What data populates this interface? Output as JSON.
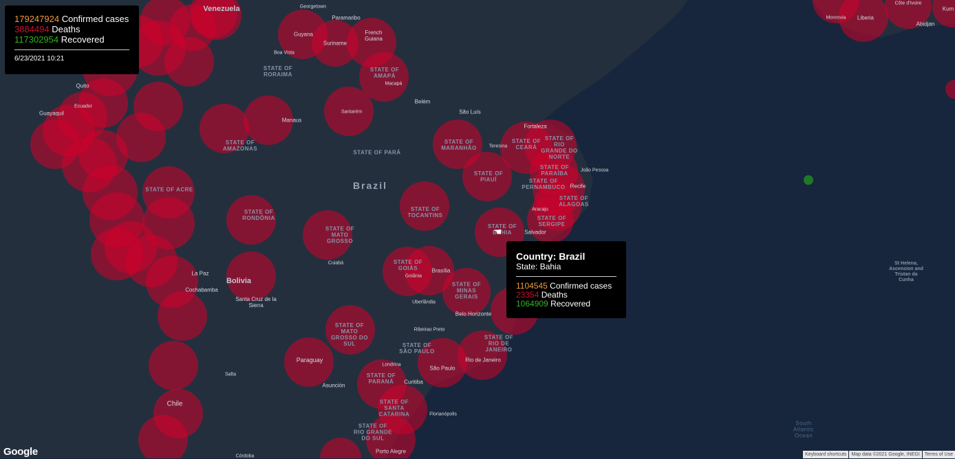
{
  "summary": {
    "confirmed": "179247924",
    "confirmed_label": "Confirmed cases",
    "deaths": "3884494",
    "deaths_label": "Deaths",
    "recovered": "117302954",
    "recovered_label": "Recovered",
    "timestamp": "6/23/2021 10:21"
  },
  "tooltip": {
    "country": "Country: Brazil",
    "state": "State: Bahia",
    "confirmed": "1104545",
    "confirmed_label": "Confirmed cases",
    "deaths": "23354",
    "deaths_label": "Deaths",
    "recovered": "1064909",
    "recovered_label": "Recovered"
  },
  "map_labels": {
    "country_brazil": "Brazil",
    "country_venezuela": "Venezuela",
    "country_bolivia": "Bolivia",
    "country_paraguay": "Paraguay",
    "country_chile": "Chile",
    "country_guyana": "Guyana",
    "country_suriname": "Suriname",
    "country_french_guiana": "French Guiana",
    "country_ecuador": "Ecuador",
    "country_liberia": "Liberia",
    "country_cote": "Côte d'Ivoire",
    "state_roraima": "STATE OF RORAIMA",
    "state_amapa": "STATE OF AMAPÁ",
    "state_amazonas": "STATE OF AMAZONAS",
    "state_para": "STATE OF PARÁ",
    "state_maranhao": "STATE OF MARANHÃO",
    "state_ceara": "STATE OF CEARÁ",
    "state_rgn": "STATE OF RIO GRANDE DO NORTE",
    "state_piaui": "STATE OF PIAUÍ",
    "state_acre": "STATE OF ACRE",
    "state_rondonia": "STATE OF RONDÔNIA",
    "state_tocantins": "STATE OF TOCANTINS",
    "state_bahia": "STATE OF BAHIA",
    "state_pernambuco": "STATE OF PERNAMBUCO",
    "state_paraiba": "STATE OF PARAÍBA",
    "state_alagoas": "STATE OF ALAGOAS",
    "state_sergipe": "STATE OF SERGIPE",
    "state_mato_grosso": "STATE OF MATO GROSSO",
    "state_goias": "STATE OF GOIÁS",
    "state_minas": "STATE OF MINAS GERAIS",
    "state_ms": "STATE OF MATO GROSSO DO SUL",
    "state_sp": "STATE OF SÃO PAULO",
    "state_rj": "STATE OF RIO DE JANEIRO",
    "state_parana": "STATE OF PARANÁ",
    "state_sc": "STATE OF SANTA CATARINA",
    "state_rgs": "STATE OF RIO GRANDE DO SUL",
    "city_georgetown": "Georgetown",
    "city_paramaribo": "Paramaribo",
    "city_boa_vista": "Boa Vista",
    "city_macapa": "Macapá",
    "city_belem": "Belém",
    "city_sao_luis": "São Luís",
    "city_fortaleza": "Fortaleza",
    "city_teresina": "Teresina",
    "city_joao_pessoa": "João Pessoa",
    "city_recife": "Recife",
    "city_manaus": "Manaus",
    "city_santarem": "Santarém",
    "city_quito": "Quito",
    "city_guayaquil": "Guayaquil",
    "city_salvador": "Salvador",
    "city_aracaju": "Aracaju",
    "city_brasilia": "Brasília",
    "city_goiania": "Goiânia",
    "city_cuiaba": "Cuiabá",
    "city_la_paz": "La Paz",
    "city_cochabamba": "Cochabamba",
    "city_santa_cruz": "Santa Cruz de la Sierra",
    "city_uberlandia": "Uberlândia",
    "city_belo_horizonte": "Belo Horizonte",
    "city_ribeirao_preto": "Ribeirao Preto",
    "city_sao_paulo": "São Paulo",
    "city_rio": "Rio de Janeiro",
    "city_londrina": "Londrina",
    "city_curitiba": "Curitiba",
    "city_florianopolis": "Florianópolis",
    "city_porto_alegre": "Porto Alegre",
    "city_asuncion": "Asunción",
    "city_salta": "Salta",
    "city_cordoba": "Córdoba",
    "city_monrovia": "Monrovia",
    "city_abidjan": "Abidjan",
    "city_kumasi": "Kum",
    "islands_st_helena": "St Helena, Ascension and Tristan da Cunha",
    "ocean_south_atlantic": "South Atlantic Ocean"
  },
  "branding": {
    "google": "Google"
  },
  "attribution": {
    "shortcuts": "Keyboard shortcuts",
    "map_data": "Map data ©2021 Google, INEGI",
    "terms": "Terms of Use"
  },
  "colors": {
    "ocean": "#17263c",
    "land": "#242f3e",
    "bubble": "#d1002a",
    "recovered_dot": "#1e7a28",
    "confirmed_text": "#f39c34",
    "deaths_text": "#c8102e",
    "recovered_text": "#31b424"
  }
}
